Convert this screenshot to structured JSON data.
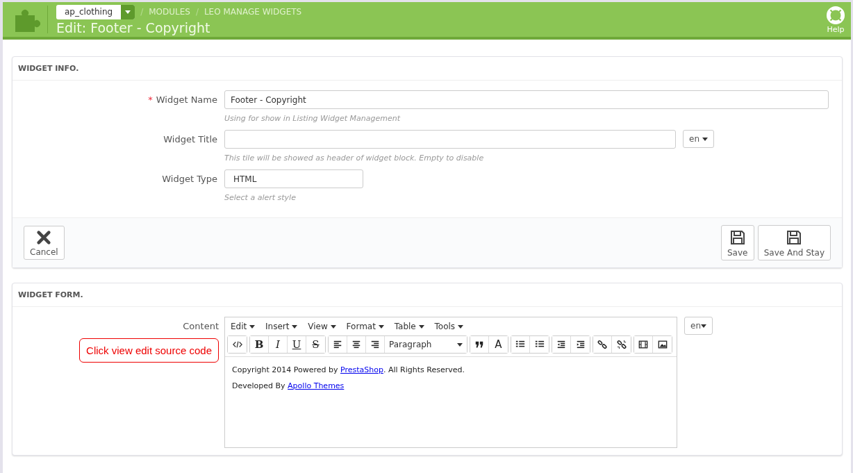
{
  "header": {
    "shop": "ap_clothing",
    "separator": "/",
    "breadcrumb": [
      "MODULES",
      "LEO MANAGE WIDGETS"
    ],
    "title": "Edit: Footer - Copyright",
    "help": "Help"
  },
  "info_panel": {
    "heading": "WIDGET INFO.",
    "fields": [
      {
        "kind": "text",
        "label": "Widget Name",
        "required_mark": "*",
        "value": "Footer - Copyright",
        "hint": "Using for show in Listing Widget Management"
      },
      {
        "kind": "lang",
        "label": "Widget Title",
        "lang": "en",
        "hint": "This tile will be showed as header of widget block. Empty to disable"
      },
      {
        "kind": "short",
        "label": "Widget Type",
        "value": "HTML",
        "hint": "Select a alert style"
      }
    ],
    "buttons": [
      {
        "kind": "cancel",
        "label": "Cancel"
      },
      {
        "kind": "save",
        "label": "Save"
      },
      {
        "kind": "save",
        "label": "Save And Stay"
      }
    ]
  },
  "form_panel": {
    "heading": "WIDGET FORM.",
    "label": "Content",
    "lang": "en",
    "menus": [
      "Edit",
      "Insert",
      "View",
      "Format",
      "Table",
      "Tools"
    ],
    "toolbar": [
      [
        {
          "kind": "code"
        }
      ],
      [
        {
          "kind": "bold",
          "label": "B"
        },
        {
          "kind": "italic",
          "label": "I"
        },
        {
          "kind": "underline",
          "label": "U"
        },
        {
          "kind": "strike",
          "label": "S"
        }
      ],
      [
        {
          "kind": "align-left"
        },
        {
          "kind": "align-center"
        },
        {
          "kind": "align-right"
        },
        {
          "kind": "select",
          "label": "Paragraph"
        }
      ],
      [
        {
          "kind": "quote"
        },
        {
          "kind": "color",
          "label": "A"
        }
      ],
      [
        {
          "kind": "bullets"
        },
        {
          "kind": "numbers"
        }
      ],
      [
        {
          "kind": "outdent"
        },
        {
          "kind": "indent"
        }
      ],
      [
        {
          "kind": "link"
        },
        {
          "kind": "unlink"
        }
      ],
      [
        {
          "kind": "video"
        },
        {
          "kind": "image"
        }
      ]
    ],
    "callout": "Click view edit source code",
    "body": [
      {
        "before": "Copyright 2014 Powered by ",
        "link": "PrestaShop",
        "after": ". All Rights Reserved."
      },
      {
        "before": "Developed By ",
        "link": "Apollo Themes"
      }
    ]
  }
}
